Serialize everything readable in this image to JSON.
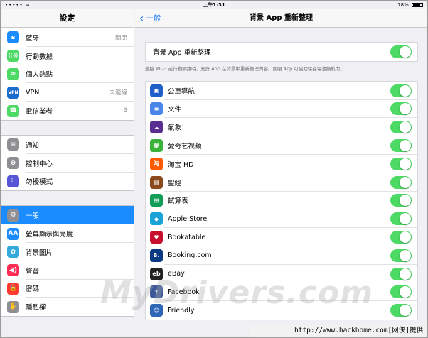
{
  "statusbar": {
    "carrier": "••••• ≈",
    "time": "上午1:31",
    "battery": "78%"
  },
  "sidebar": {
    "title": "設定",
    "groups": [
      [
        {
          "label": "藍牙",
          "value": "關閉",
          "icon": "bluetooth-icon",
          "color": "#1a8cff",
          "glyph": "ʙ"
        },
        {
          "label": "行動數據",
          "value": "",
          "icon": "cellular-icon",
          "color": "#4cd964",
          "glyph": "((·))"
        },
        {
          "label": "個人熱點",
          "value": "",
          "icon": "hotspot-icon",
          "color": "#4cd964",
          "glyph": "∞"
        },
        {
          "label": "VPN",
          "value": "未連線",
          "icon": "vpn-icon",
          "color": "#1a6bcc",
          "glyph": "VPN"
        },
        {
          "label": "電信業者",
          "value": "3",
          "icon": "phone-icon",
          "color": "#4cd964",
          "glyph": "☎"
        }
      ],
      [
        {
          "label": "通知",
          "value": "",
          "icon": "notifications-icon",
          "color": "#8e8e93",
          "glyph": "≡"
        },
        {
          "label": "控制中心",
          "value": "",
          "icon": "control-center-icon",
          "color": "#8e8e93",
          "glyph": "⊜"
        },
        {
          "label": "勿擾模式",
          "value": "",
          "icon": "moon-icon",
          "color": "#5856d6",
          "glyph": "☾"
        }
      ],
      [
        {
          "label": "一般",
          "value": "",
          "icon": "gear-icon",
          "color": "#8e8e93",
          "glyph": "⚙",
          "selected": true
        },
        {
          "label": "螢幕顯示與亮度",
          "value": "",
          "icon": "brightness-icon",
          "color": "#1a8cff",
          "glyph": "AA"
        },
        {
          "label": "背景圖片",
          "value": "",
          "icon": "wallpaper-icon",
          "color": "#34aadc",
          "glyph": "✿"
        },
        {
          "label": "聲音",
          "value": "",
          "icon": "sound-icon",
          "color": "#ff2d55",
          "glyph": "◀)"
        },
        {
          "label": "密碼",
          "value": "",
          "icon": "lock-icon",
          "color": "#ff3b30",
          "glyph": "🔒"
        },
        {
          "label": "隱私權",
          "value": "",
          "icon": "privacy-hand-icon",
          "color": "#8e8e93",
          "glyph": "✋"
        }
      ]
    ]
  },
  "navbar": {
    "back_label": "一般",
    "title": "背景 App 重新整理"
  },
  "master": {
    "label": "背景 App 重新整理",
    "on": true
  },
  "footnote": "連接 Wi-Fi 或行動網路時，允許 App 在背景中重新整理內容。關閉 App 可協助保存電池續航力。",
  "apps": [
    {
      "label": "公車導航",
      "icon": "bus-icon",
      "color": "#1e5fc8",
      "glyph": "▣"
    },
    {
      "label": "文件",
      "icon": "docs-icon",
      "color": "#4a86e8",
      "glyph": "≣"
    },
    {
      "label": "氣象！",
      "icon": "weather-icon",
      "color": "#5b2d90",
      "glyph": "☁"
    },
    {
      "label": "愛奇艺视频",
      "icon": "iqiyi-icon",
      "color": "#3bb33b",
      "glyph": "愛"
    },
    {
      "label": "淘宝 HD",
      "icon": "taobao-icon",
      "color": "#ff5a00",
      "glyph": "淘"
    },
    {
      "label": "聖經",
      "icon": "bible-icon",
      "color": "#8b4a1c",
      "glyph": "▤"
    },
    {
      "label": "試算表",
      "icon": "sheets-icon",
      "color": "#0f9d58",
      "glyph": "⊞"
    },
    {
      "label": "Apple Store",
      "icon": "apple-store-icon",
      "color": "#1ba3d8",
      "glyph": "◆"
    },
    {
      "label": "Bookatable",
      "icon": "bookatable-icon",
      "color": "#c8102e",
      "glyph": "♥"
    },
    {
      "label": "Booking.com",
      "icon": "booking-icon",
      "color": "#0b3a82",
      "glyph": "B."
    },
    {
      "label": "eBay",
      "icon": "ebay-icon",
      "color": "#222222",
      "glyph": "eb"
    },
    {
      "label": "Facebook",
      "icon": "facebook-icon",
      "color": "#3b5998",
      "glyph": "f"
    },
    {
      "label": "Friendly",
      "icon": "friendly-icon",
      "color": "#2f66b5",
      "glyph": "☺"
    }
  ],
  "watermark": "MyDrivers.com",
  "source": "http://www.hackhome.com[网侠]提供",
  "colors": {
    "accent": "#1a8cff",
    "toggle_on": "#4cd964",
    "back_link": "#1a7cf6"
  }
}
